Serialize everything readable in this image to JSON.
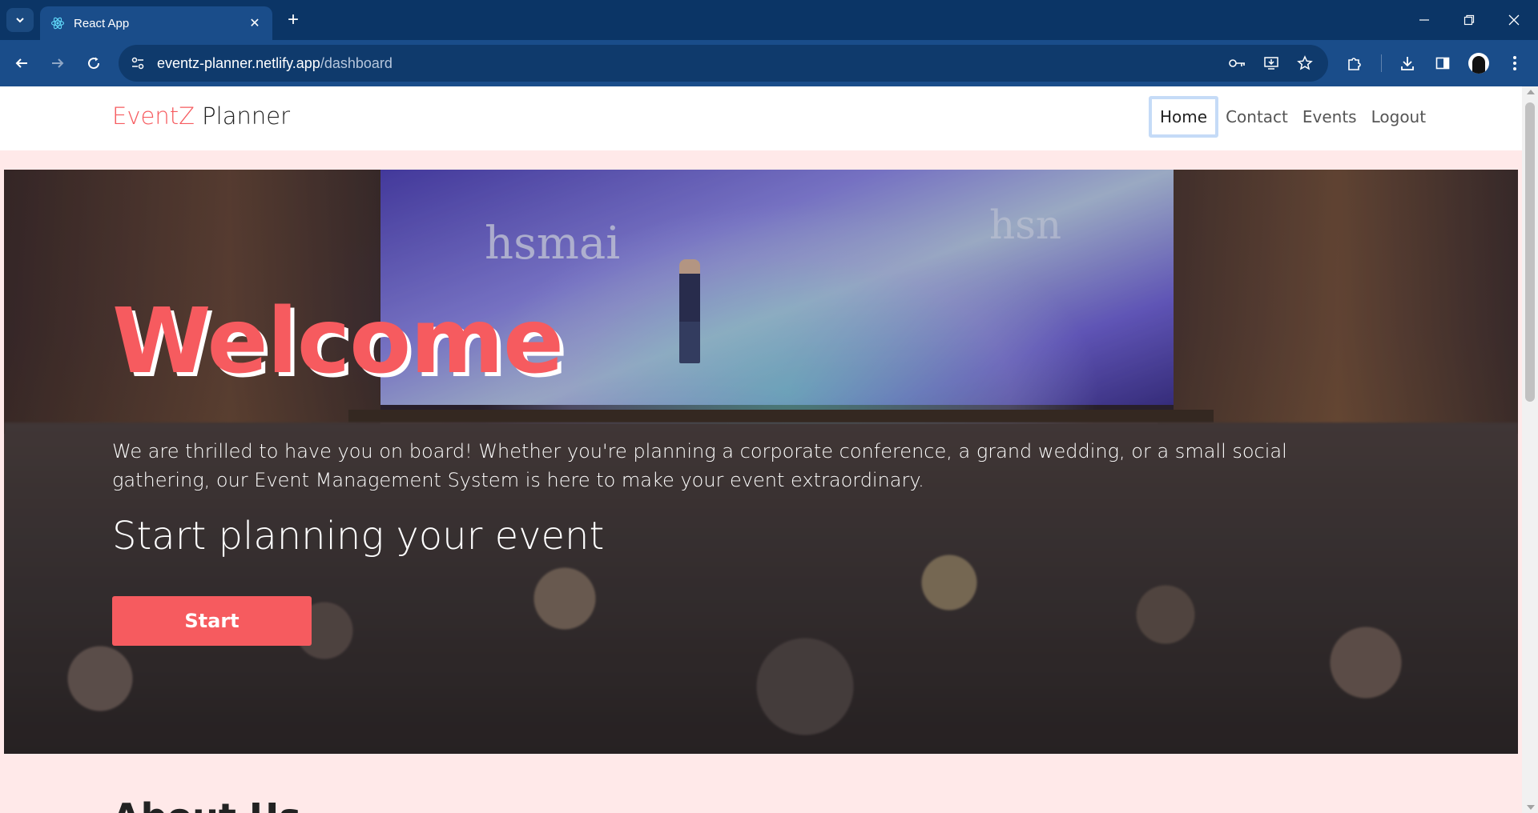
{
  "browser": {
    "tab_title": "React App",
    "url_host": "eventz-planner.netlify.app",
    "url_path": "/dashboard"
  },
  "navbar": {
    "brand_accent": "EventZ",
    "brand_rest": " Planner",
    "links": [
      {
        "label": "Home",
        "active": true
      },
      {
        "label": "Contact",
        "active": false
      },
      {
        "label": "Events",
        "active": false
      },
      {
        "label": "Logout",
        "active": false
      }
    ]
  },
  "hero": {
    "title": "Welcome",
    "text": "We are thrilled to have you on board! Whether you're planning a corporate conference, a grand wedding, or a small social gathering, our Event Management System is here to make your event extraordinary.",
    "subtitle": "Start planning your event",
    "button_label": "Start",
    "stage_logo": "hsmai",
    "stage_logo_partial": "hsn"
  },
  "about": {
    "title": "About Us"
  },
  "colors": {
    "accent": "#f65b5f",
    "chrome_dark": "#0b3566",
    "chrome_toolbar": "#1a4d8a",
    "page_bg": "#ffe9e9"
  }
}
